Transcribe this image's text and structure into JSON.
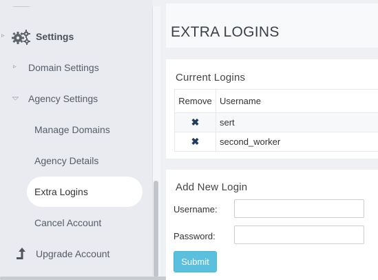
{
  "sidebar": {
    "settings": {
      "label": "Settings",
      "icon": "gears-icon"
    },
    "items": [
      {
        "label": "Domain Settings"
      },
      {
        "label": "Agency Settings"
      },
      {
        "label": "Manage Domains"
      },
      {
        "label": "Agency Details"
      },
      {
        "label": "Extra Logins",
        "active": true
      },
      {
        "label": "Cancel Account"
      },
      {
        "label": "Upgrade Account",
        "icon": "arrow-up-icon"
      }
    ]
  },
  "page": {
    "title": "EXTRA LOGINS"
  },
  "current_logins": {
    "title": "Current Logins",
    "columns": [
      "Remove",
      "Username"
    ],
    "remove_glyph": "✖",
    "rows": [
      {
        "username": "sert"
      },
      {
        "username": "second_worker"
      }
    ]
  },
  "new_login": {
    "title": "Add New Login",
    "username_label": "Username:",
    "password_label": "Password:",
    "username_value": "",
    "password_value": "",
    "submit_label": "Submit"
  },
  "colors": {
    "accent": "#5bc0de",
    "sidebar_bg": "#e9ebf0",
    "remove_icon": "#1f3b5e"
  }
}
